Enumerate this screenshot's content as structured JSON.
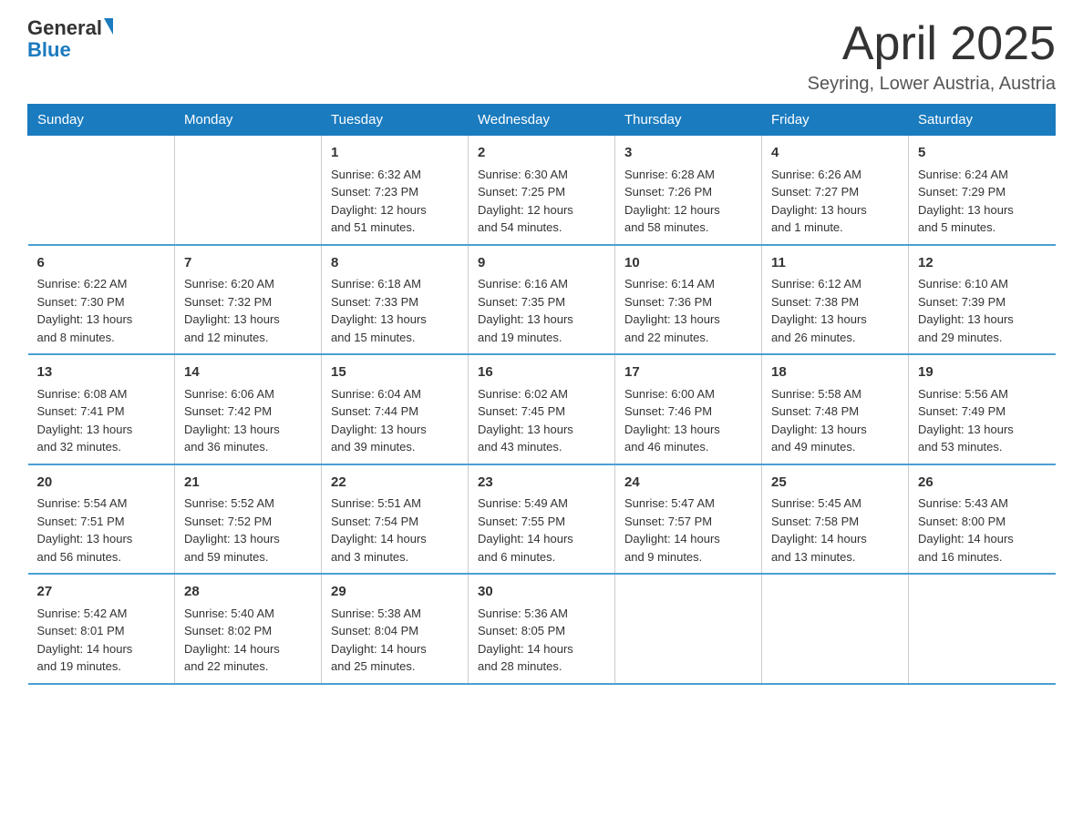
{
  "header": {
    "logo_general": "General",
    "logo_blue": "Blue",
    "month_title": "April 2025",
    "subtitle": "Seyring, Lower Austria, Austria"
  },
  "days_of_week": [
    "Sunday",
    "Monday",
    "Tuesday",
    "Wednesday",
    "Thursday",
    "Friday",
    "Saturday"
  ],
  "weeks": [
    [
      {
        "day": "",
        "info": ""
      },
      {
        "day": "",
        "info": ""
      },
      {
        "day": "1",
        "info": "Sunrise: 6:32 AM\nSunset: 7:23 PM\nDaylight: 12 hours\nand 51 minutes."
      },
      {
        "day": "2",
        "info": "Sunrise: 6:30 AM\nSunset: 7:25 PM\nDaylight: 12 hours\nand 54 minutes."
      },
      {
        "day": "3",
        "info": "Sunrise: 6:28 AM\nSunset: 7:26 PM\nDaylight: 12 hours\nand 58 minutes."
      },
      {
        "day": "4",
        "info": "Sunrise: 6:26 AM\nSunset: 7:27 PM\nDaylight: 13 hours\nand 1 minute."
      },
      {
        "day": "5",
        "info": "Sunrise: 6:24 AM\nSunset: 7:29 PM\nDaylight: 13 hours\nand 5 minutes."
      }
    ],
    [
      {
        "day": "6",
        "info": "Sunrise: 6:22 AM\nSunset: 7:30 PM\nDaylight: 13 hours\nand 8 minutes."
      },
      {
        "day": "7",
        "info": "Sunrise: 6:20 AM\nSunset: 7:32 PM\nDaylight: 13 hours\nand 12 minutes."
      },
      {
        "day": "8",
        "info": "Sunrise: 6:18 AM\nSunset: 7:33 PM\nDaylight: 13 hours\nand 15 minutes."
      },
      {
        "day": "9",
        "info": "Sunrise: 6:16 AM\nSunset: 7:35 PM\nDaylight: 13 hours\nand 19 minutes."
      },
      {
        "day": "10",
        "info": "Sunrise: 6:14 AM\nSunset: 7:36 PM\nDaylight: 13 hours\nand 22 minutes."
      },
      {
        "day": "11",
        "info": "Sunrise: 6:12 AM\nSunset: 7:38 PM\nDaylight: 13 hours\nand 26 minutes."
      },
      {
        "day": "12",
        "info": "Sunrise: 6:10 AM\nSunset: 7:39 PM\nDaylight: 13 hours\nand 29 minutes."
      }
    ],
    [
      {
        "day": "13",
        "info": "Sunrise: 6:08 AM\nSunset: 7:41 PM\nDaylight: 13 hours\nand 32 minutes."
      },
      {
        "day": "14",
        "info": "Sunrise: 6:06 AM\nSunset: 7:42 PM\nDaylight: 13 hours\nand 36 minutes."
      },
      {
        "day": "15",
        "info": "Sunrise: 6:04 AM\nSunset: 7:44 PM\nDaylight: 13 hours\nand 39 minutes."
      },
      {
        "day": "16",
        "info": "Sunrise: 6:02 AM\nSunset: 7:45 PM\nDaylight: 13 hours\nand 43 minutes."
      },
      {
        "day": "17",
        "info": "Sunrise: 6:00 AM\nSunset: 7:46 PM\nDaylight: 13 hours\nand 46 minutes."
      },
      {
        "day": "18",
        "info": "Sunrise: 5:58 AM\nSunset: 7:48 PM\nDaylight: 13 hours\nand 49 minutes."
      },
      {
        "day": "19",
        "info": "Sunrise: 5:56 AM\nSunset: 7:49 PM\nDaylight: 13 hours\nand 53 minutes."
      }
    ],
    [
      {
        "day": "20",
        "info": "Sunrise: 5:54 AM\nSunset: 7:51 PM\nDaylight: 13 hours\nand 56 minutes."
      },
      {
        "day": "21",
        "info": "Sunrise: 5:52 AM\nSunset: 7:52 PM\nDaylight: 13 hours\nand 59 minutes."
      },
      {
        "day": "22",
        "info": "Sunrise: 5:51 AM\nSunset: 7:54 PM\nDaylight: 14 hours\nand 3 minutes."
      },
      {
        "day": "23",
        "info": "Sunrise: 5:49 AM\nSunset: 7:55 PM\nDaylight: 14 hours\nand 6 minutes."
      },
      {
        "day": "24",
        "info": "Sunrise: 5:47 AM\nSunset: 7:57 PM\nDaylight: 14 hours\nand 9 minutes."
      },
      {
        "day": "25",
        "info": "Sunrise: 5:45 AM\nSunset: 7:58 PM\nDaylight: 14 hours\nand 13 minutes."
      },
      {
        "day": "26",
        "info": "Sunrise: 5:43 AM\nSunset: 8:00 PM\nDaylight: 14 hours\nand 16 minutes."
      }
    ],
    [
      {
        "day": "27",
        "info": "Sunrise: 5:42 AM\nSunset: 8:01 PM\nDaylight: 14 hours\nand 19 minutes."
      },
      {
        "day": "28",
        "info": "Sunrise: 5:40 AM\nSunset: 8:02 PM\nDaylight: 14 hours\nand 22 minutes."
      },
      {
        "day": "29",
        "info": "Sunrise: 5:38 AM\nSunset: 8:04 PM\nDaylight: 14 hours\nand 25 minutes."
      },
      {
        "day": "30",
        "info": "Sunrise: 5:36 AM\nSunset: 8:05 PM\nDaylight: 14 hours\nand 28 minutes."
      },
      {
        "day": "",
        "info": ""
      },
      {
        "day": "",
        "info": ""
      },
      {
        "day": "",
        "info": ""
      }
    ]
  ]
}
